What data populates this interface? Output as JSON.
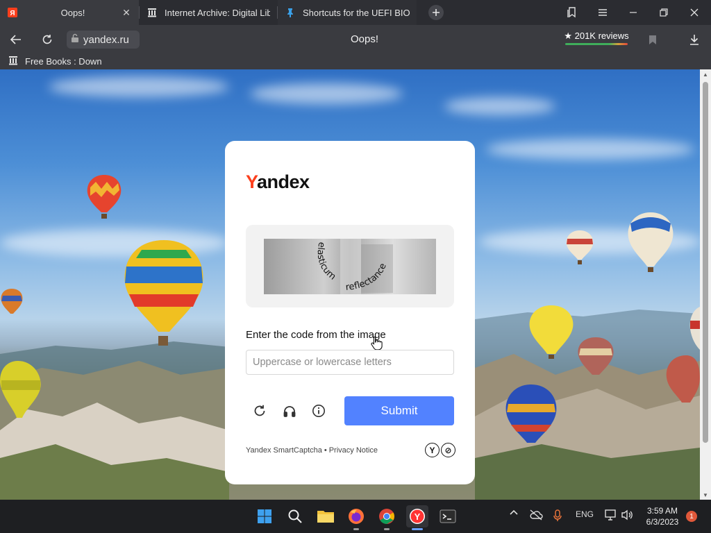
{
  "browser": {
    "tabs": [
      {
        "title": "Oops!",
        "favicon": "yandex-y-icon"
      },
      {
        "title": "Internet Archive: Digital Lib",
        "favicon": "archive-building-icon"
      },
      {
        "title": "Shortcuts for the UEFI BIOS",
        "favicon": "pin-icon"
      }
    ],
    "new_tab_icon": "plus-icon",
    "window_controls": [
      "collections-icon",
      "menu-icon",
      "minimize-icon",
      "restore-icon",
      "close-icon"
    ],
    "address": {
      "url": "yandex.ru",
      "page_title": "Oops!",
      "reviews": "★ 201K reviews"
    },
    "bookmarks": [
      {
        "label": "Free Books : Download",
        "icon": "archive-building-icon"
      }
    ]
  },
  "captcha": {
    "logo_y": "Y",
    "logo_rest": "andex",
    "captcha_words": [
      "elasticum",
      "reflectance"
    ],
    "prompt": "Enter the code from the image",
    "input_placeholder": "Uppercase or lowercase letters",
    "input_value": "",
    "tools": [
      "refresh-icon",
      "audio-headphones-icon",
      "info-icon"
    ],
    "submit_label": "Submit",
    "footer_service": "Yandex SmartCaptcha",
    "footer_separator": "•",
    "footer_privacy": "Privacy Notice",
    "badges": [
      "Y",
      "⊘"
    ]
  },
  "taskbar": {
    "apps": [
      "windows-start-icon",
      "search-icon",
      "file-explorer-icon",
      "firefox-icon",
      "chrome-icon",
      "yandex-browser-icon",
      "terminal-icon"
    ],
    "active_app": "yandex-browser-icon",
    "tray": {
      "language": "ENG",
      "time": "3:59 AM",
      "date": "6/3/2023",
      "notifications": "1"
    }
  },
  "colors": {
    "accent": "#5282ff",
    "yandex_red": "#fc3f1d",
    "tab_bg": "#2b2c31",
    "toolbar_bg": "#3a3b40"
  }
}
